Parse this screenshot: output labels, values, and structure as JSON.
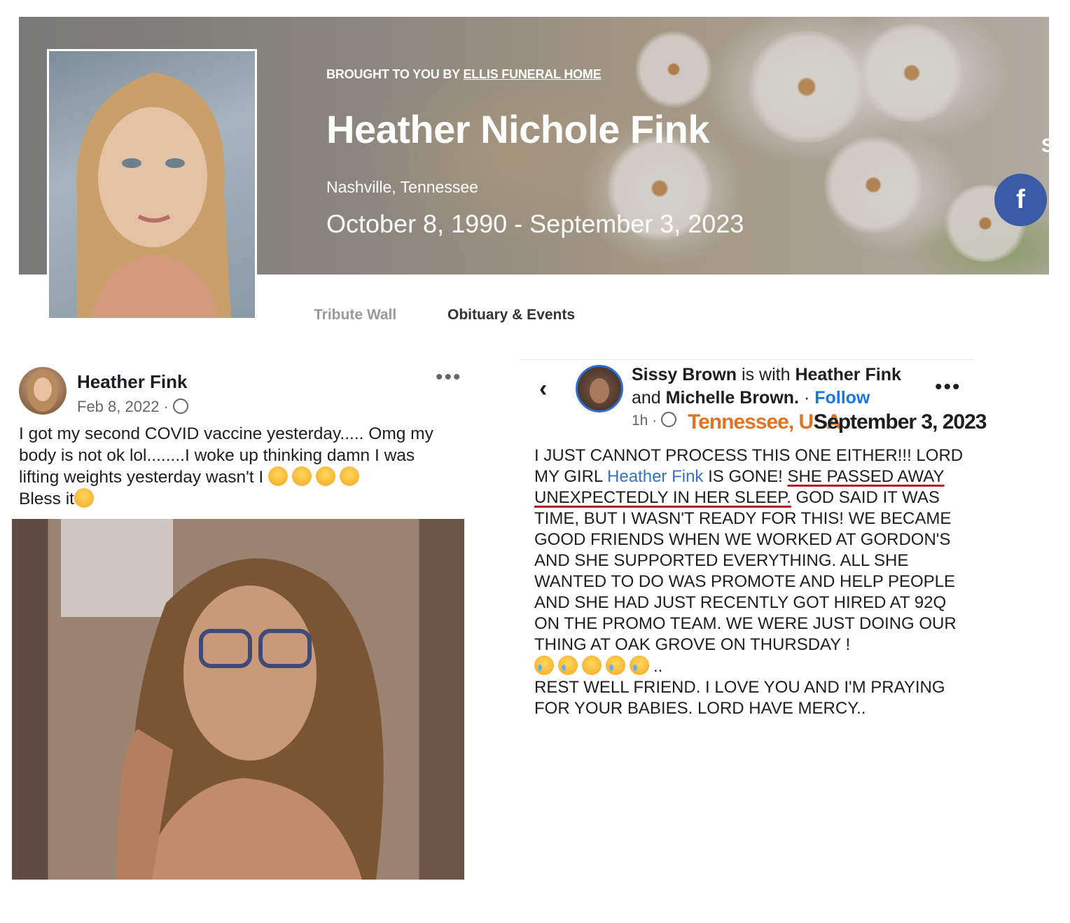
{
  "obituary": {
    "brought_prefix": "BROUGHT TO YOU BY",
    "funeral_home": "ELLIS FUNERAL HOME",
    "name": "Heather Nichole Fink",
    "location": "Nashville, Tennessee",
    "dates": "October 8, 1990 - September 3, 2023",
    "facebook_icon": "f",
    "edge_letter": "S",
    "tabs": [
      {
        "label": "Tribute Wall"
      },
      {
        "label": "Obituary & Events"
      }
    ]
  },
  "post_left": {
    "author": "Heather Fink",
    "date": "Feb 8, 2022 ·",
    "more": "•••",
    "text_line1": "I got my second COVID vaccine yesterday..... Omg my body is not ok lol........I woke up thinking damn I was lifting weights yesterday wasn't I",
    "text_line2": "Bless it",
    "emojis": [
      "joy-emoji",
      "weary-emoji",
      "weary-emoji",
      "weary-emoji",
      "unamused-emoji"
    ]
  },
  "post_right": {
    "back": "‹",
    "author": "Sissy Brown",
    "with_text": "is with",
    "tagged1": "Heather Fink",
    "and_text": "and",
    "tagged2": "Michelle Brown.",
    "dot": "·",
    "follow": "Follow",
    "more": "•••",
    "time": "1h ·",
    "stamp_location": "Tennessee, USA",
    "stamp_date": "September 3, 2023",
    "body_a": "I JUST CANNOT PROCESS THIS ONE EITHER!!! LORD MY GIRL",
    "body_tag": "Heather Fink",
    "body_b": "IS GONE!",
    "body_underlined": "SHE PASSED AWAY UNEXPECTEDLY IN HER SLEEP.",
    "body_c": "GOD SAID IT WAS TIME, BUT I WASN'T READY FOR THIS! WE BECAME GOOD FRIENDS WHEN WE WORKED AT GORDON'S AND SHE SUPPORTED EVERYTHING. ALL SHE WANTED TO DO WAS PROMOTE AND HELP PEOPLE AND SHE HAD JUST RECENTLY GOT HIRED AT 92Q ON THE PROMO TEAM.  WE WERE JUST DOING OUR THING AT OAK GROVE ON THURSDAY !",
    "emoji_tail": "..",
    "body_d": "REST WELL FRIEND. I LOVE YOU AND I'M PRAYING FOR YOUR BABIES.  LORD HAVE MERCY..",
    "emojis": [
      "crying-emoji",
      "crying-emoji",
      "sad-emoji",
      "sobbing-emoji",
      "sobbing-emoji"
    ]
  }
}
